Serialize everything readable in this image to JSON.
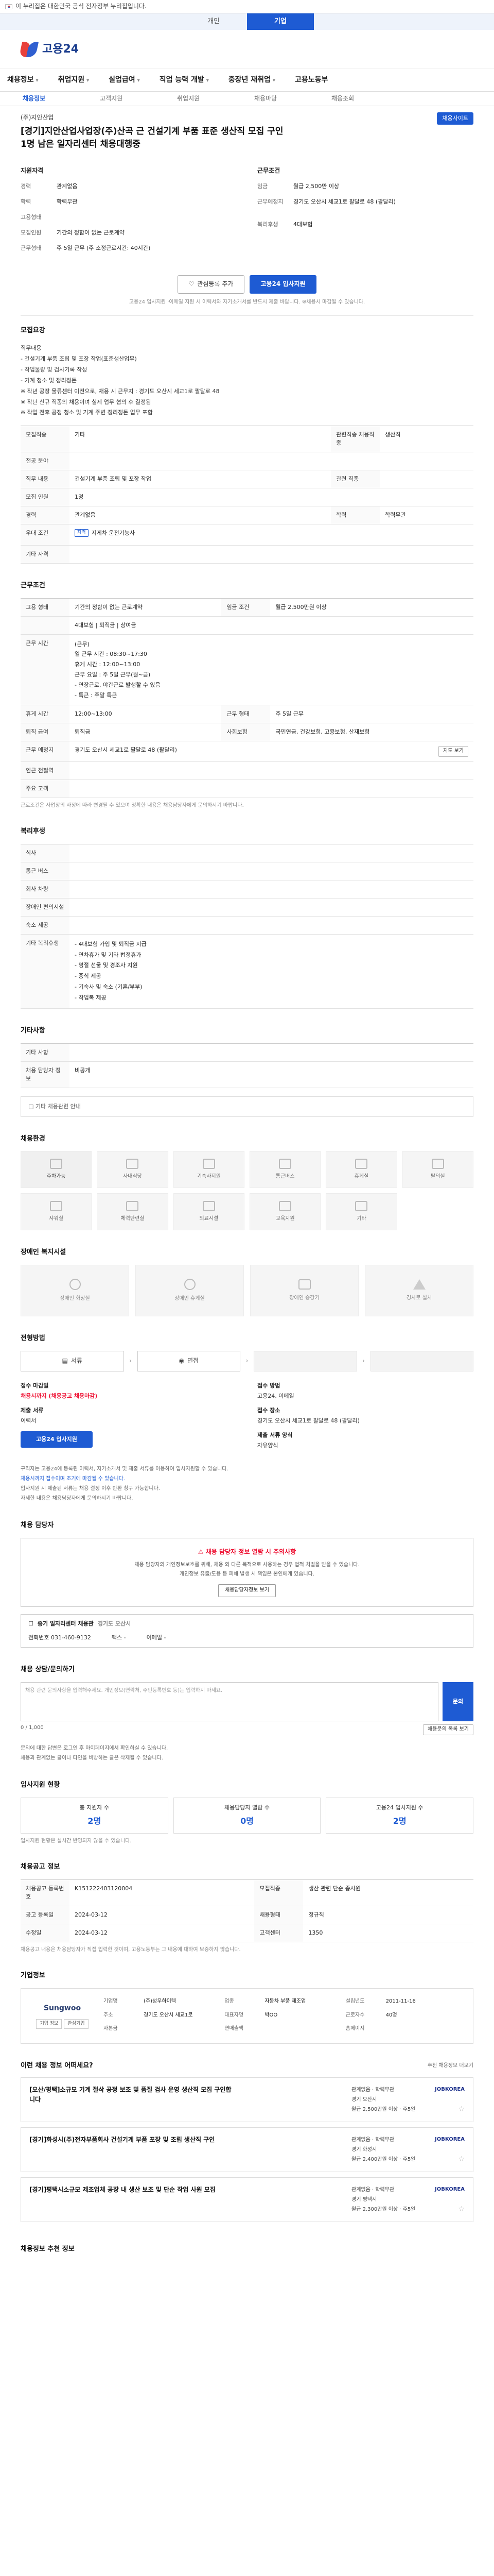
{
  "topbar": {
    "notice": "이 누리집은 대한민국 공식 전자정부 누리집입니다."
  },
  "top_tabs": [
    "개인",
    "기업"
  ],
  "logo_text": "고용24",
  "gnb": [
    "채용정보",
    "취업지원",
    "실업급여",
    "직업 능력 개발",
    "중장년 재취업",
    "고용노동부"
  ],
  "subnav": [
    "채용정보",
    "고객지원",
    "취업지원",
    "채용마당",
    "채용조회"
  ],
  "job": {
    "company": "(주)지안산업",
    "title": "[경기]지안산업사업장(주)산곡 근 건설기계 부품 표준 생산직 모집 구인 1명 남은 일자리센터 채용대행중",
    "wanted_btn": "채용사이트"
  },
  "summary": {
    "left_head": "지원자격",
    "right_head": "근무조건",
    "left": [
      {
        "k": "경력",
        "v": "관계없음"
      },
      {
        "k": "학력",
        "v": "학력무관"
      },
      {
        "k": "고용형태",
        "v": ""
      },
      {
        "k": "모집인원",
        "v": "기간의 정함이 없는 근로계약"
      },
      {
        "k": "근무형태",
        "v": "주 5일 근무 (주 소정근로시간: 40시간)"
      }
    ],
    "right": [
      {
        "k": "임금",
        "v": "월급 2,500만 이상"
      },
      {
        "k": "근무예정지",
        "v": "경기도 오산시 세교1로 팔달로 48 (팔달리)"
      },
      {
        "k": "",
        "v": ""
      },
      {
        "k": "복리후생",
        "v": "4대보험"
      },
      {
        "k": "",
        "v": ""
      }
    ]
  },
  "actions": {
    "bookmark": "관심등록 추가",
    "apply": "고용24 입사지원"
  },
  "notice_line": "고용24 입사지원 ·이메일 지원 시 이력서와 자기소개서를 반드시 제출 바랍니다. ※채용시 마감될 수 있습니다.",
  "sec_recruit": {
    "title": "모집요강",
    "text": "직무내용\n - 건설기계 부품 조립 및 포장 작업(표준생산업무)\n - 작업물량 및 검사기록 작성\n - 기계 청소 및 정리정돈\n ※ 작년 공장 물류센터 이전으로, 채용 시 근무지 : 경기도 오산시 세교1로 팔달로 48\n ※ 작년 신규 직종의 채용이며 실제 업무 협의 후 결정됨\n ※ 작업 전후 공정 청소 및 기계 주변 정리정돈 업무 포함"
  },
  "tbl1": [
    [
      "모집직종",
      "기타",
      "관련직종 채용직종",
      "생산직"
    ],
    [
      "전공 분야",
      "",
      "",
      ""
    ],
    [
      "직무 내용",
      "건설기계 부품 조립 및 포장 작업",
      "관련 직종",
      ""
    ],
    [
      "모집 인원",
      "1명",
      "",
      ""
    ],
    [
      "경력",
      "관계없음",
      "학력",
      "학력무관"
    ],
    [
      "우대 조건",
      "지게차 운전기능사",
      "",
      ""
    ],
    [
      "기타 자격",
      "",
      "",
      ""
    ]
  ],
  "sec_work": {
    "title": "근무조건"
  },
  "tbl2": [
    [
      "고용 형태",
      "기간의 정함이 없는 근로계약",
      "임금 조건",
      "월급 2,500만원 이상"
    ],
    [
      "",
      "4대보험 | 퇴직금 | 상여금",
      "",
      ""
    ],
    [
      "근무 시간",
      "(근무)\n일 근무 시간 : 08:30~17:30\n휴게 시간 : 12:00~13:00\n근무 요일 : 주 5일 근무(월~금)\n  - 연장근로, 야간근로 발생할 수 있음\n  - 특근 : 주말 특근",
      "",
      ""
    ],
    [
      "휴게 시간",
      "12:00~13:00",
      "근무 형태",
      "주 5일 근무"
    ],
    [
      "퇴직 급여",
      "퇴직금",
      "사회보험",
      "국민연금, 건강보험, 고용보험, 산재보험"
    ],
    [
      "근무 예정지",
      "경기도 오산시 세교1로 팔달로 48 (팔달리)",
      "",
      ""
    ],
    [
      "인근 전철역",
      "",
      "",
      ""
    ],
    [
      "주요 고객",
      "",
      "",
      ""
    ]
  ],
  "map_btn": "지도 보기",
  "work_note": "근로조건은 사업장의 사정에 따라 변경될 수 있으며 정확한 내용은 채용담당자에게 문의하시기 바랍니다.",
  "sec_welfare": {
    "title": "복리후생"
  },
  "tbl3": [
    [
      "식사",
      ""
    ],
    [
      "통근 버스",
      ""
    ],
    [
      "회사 차량",
      ""
    ],
    [
      "장애인 편의시설",
      ""
    ],
    [
      "숙소 제공",
      ""
    ],
    [
      "기타 복리후생",
      "- 4대보험 가입 및 퇴직금 지급\n- 연차휴가 및 기타 법정휴가\n- 명절 선물 및 경조사 지원\n- 중식 제공\n- 기숙사 및 숙소 (기혼/부부)\n- 작업복 제공"
    ]
  ],
  "sec_other": {
    "title": "기타사항"
  },
  "tbl4": [
    [
      "기타 사항",
      ""
    ],
    [
      "채용 담당자 정보",
      "비공개"
    ]
  ],
  "ofc_label": "□ 기타 채용관련 안내",
  "sec_visual": {
    "title": "채용환경"
  },
  "visual_icons": [
    "주차가능",
    "사내식당",
    "기숙사지원",
    "통근버스",
    "휴게실",
    "탈의실",
    "샤워실",
    "체력단련실",
    "의료시설",
    "교육지원",
    "기타"
  ],
  "sec_disabled": {
    "title": "장애인 복지시설",
    "cards": [
      "장애인 화장실",
      "장애인 휴게실",
      "장애인 승강기",
      "경사로 설치"
    ]
  },
  "sec_process": {
    "title": "전형방법",
    "steps": [
      "서류",
      "면접",
      "",
      ""
    ]
  },
  "apply": {
    "deadline_lbl": "접수 마감일",
    "deadline_val": "채용시까지 (채용공고 채용마감)",
    "method_lbl": "접수 방법",
    "method_val": "고용24, 이메일",
    "docs_lbl": "제출 서류",
    "docs_val": "이력서",
    "place_lbl": "접수 장소",
    "place_val": "경기도 오산시 세교1로 팔달로 48 (팔달리)",
    "extra_lbl": "제출 서류 양식",
    "extra_val": "자유양식",
    "btn": "고용24 입사지원"
  },
  "apply_bullets": [
    "구직자는 고용24에 등록된 이력서, 자기소개서 및 제출 서류를 이용하여 입사지원할 수 있습니다.",
    "채용시까지 접수이며 조기에 마감될 수 있습니다.",
    "입사지원 시 제출된 서류는 채용 결정 이후 반환 청구 가능합니다.",
    "자세한 내용은 채용담당자에게 문의하시기 바랍니다."
  ],
  "contact": {
    "title": "채용 담당자",
    "alert": "⚠ 채용 담당자 정보 열람 시 주의사항",
    "desc": "채용 담당자의 개인정보보호를 위해, 채용 외 다른 목적으로 사용하는 경우 법적 처벌을 받을 수 있습니다.\n개인정보 유출/도용 등 피해 발생 시 책임은 본인에게 있습니다.",
    "btn": "채용담당자정보 보기",
    "name": "중기 일자리센터 채용관",
    "org": "경기도 오산시",
    "phone_lbl": "전화번호",
    "phone": "031-460-9132",
    "fax_lbl": "팩스",
    "fax": "-",
    "email_lbl": "이메일",
    "email": "-"
  },
  "qa": {
    "title": "채용 상담/문의하기",
    "placeholder": "채용 관련 문의사항을 입력해주세요. 개인정보(연락처, 주민등록번호 등)는 입력하지 마세요.",
    "send": "문의",
    "count": "0 / 1,000",
    "list_btn": "채용문의 목록 보기"
  },
  "qa_bullets": [
    "문의에 대한 답변은 로그인 후 마이페이지에서 확인하실 수 있습니다.",
    "채용과 관계없는 글이나 타인을 비방하는 글은 삭제될 수 있습니다."
  ],
  "stats": {
    "title": "입사지원 현황",
    "cards": [
      {
        "lbl": "총 지원자 수",
        "num": "2명"
      },
      {
        "lbl": "채용담당자 열람 수",
        "num": "0명"
      },
      {
        "lbl": "고용24 입사지원 수",
        "num": "2명"
      }
    ],
    "note": "입사지원 현황은 실시간 반영되지 않을 수 있습니다."
  },
  "info": {
    "title": "채용공고 정보",
    "rows": [
      [
        "채용공고 등록번호",
        "K151222403120004",
        "모집직종",
        "생산 관련 단순 종사원"
      ],
      [
        "공고 등록일",
        "2024-03-12",
        "채용형태",
        "정규직"
      ],
      [
        "수정일",
        "2024-03-12",
        "고객센터",
        "1350"
      ]
    ],
    "note": "채용공고 내용은 채용담당자가 직접 입력한 것이며, 고용노동부는 그 내용에 대하여 보증하지 않습니다."
  },
  "org": {
    "title": "기업정보",
    "logo": "Sungwoo",
    "btns": [
      "기업 정보",
      "관심기업"
    ],
    "rows": [
      [
        "기업명",
        "(주)성우하이텍",
        "업종",
        "자동차 부품 제조업",
        "설립년도",
        "2011-11-16"
      ],
      [
        "주소",
        "경기도 오산시 세교1로",
        "대표자명",
        "박OO",
        "근로자수",
        "40명"
      ],
      [
        "자본금",
        "",
        "연매출액",
        "",
        "홈페이지",
        ""
      ]
    ]
  },
  "similar": {
    "title": "이런 채용 정보 어떠세요?",
    "more": "추천 채용정보 더보기",
    "items": [
      {
        "title": "[오산/평택]소규모 기계 절삭 공정 보조 및 품질 검사 운영 생산직 모집 구인합니다",
        "brand": "JOBKOREA",
        "m1": "관계없음 · 학력무관",
        "m2": "경기 오산시",
        "m3": "월급 2,500만원 이상 · 주5일"
      },
      {
        "title": "[경기]화성시(주)전자부품회사 건설기계 부품 포장 및 조립 생산직 구인",
        "brand": "JOBKOREA",
        "m1": "관계없음 · 학력무관",
        "m2": "경기 화성시",
        "m3": "월급 2,400만원 이상 · 주5일"
      },
      {
        "title": "[경기]평택시소규모 제조업체 공장 내 생산 보조 및 단순 작업 사원 모집",
        "brand": "JOBKOREA",
        "m1": "관계없음 · 학력무관",
        "m2": "경기 평택시",
        "m3": "월급 2,300만원 이상 · 주5일"
      }
    ]
  },
  "recommend": {
    "title": "채용정보 추천 정보"
  }
}
